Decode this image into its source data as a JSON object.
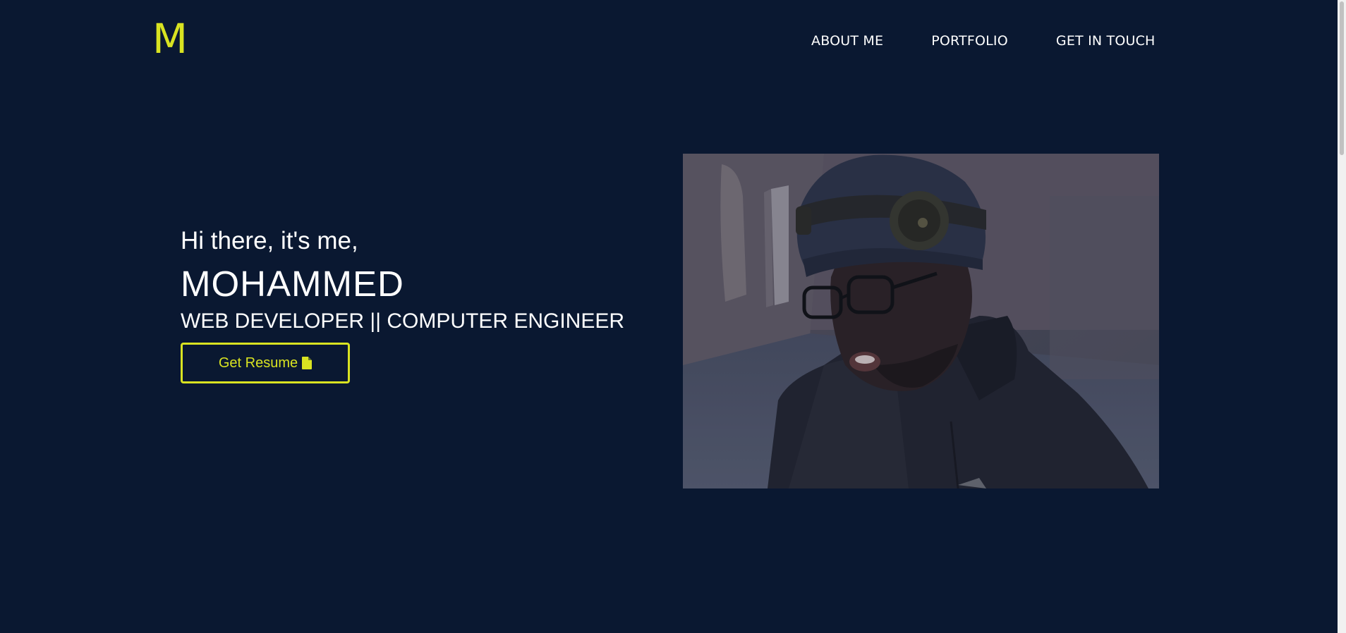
{
  "header": {
    "logo": "M",
    "nav": [
      {
        "label": "ABOUT ME"
      },
      {
        "label": "PORTFOLIO"
      },
      {
        "label": "GET IN TOUCH"
      }
    ]
  },
  "hero": {
    "greeting": "Hi there, it's me,",
    "name": "MOHAMMED",
    "role": "WEB DEVELOPER || COMPUTER ENGINEER",
    "resume_button": "Get Resume",
    "resume_icon": "file-icon"
  },
  "colors": {
    "background": "#0a1831",
    "accent": "#d9e321",
    "text": "#ffffff"
  }
}
